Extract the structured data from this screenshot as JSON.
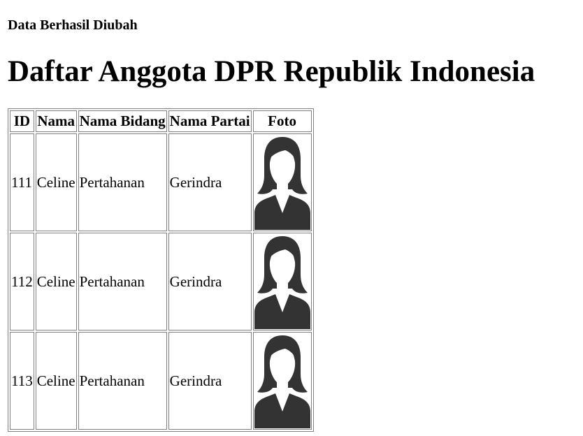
{
  "status_message": "Data Berhasil Diubah",
  "page_title": "Daftar Anggota DPR Republik Indonesia",
  "table": {
    "headers": {
      "id": "ID",
      "nama": "Nama",
      "nama_bidang": "Nama Bidang",
      "nama_partai": "Nama Partai",
      "foto": "Foto"
    },
    "rows": [
      {
        "id": "111",
        "nama": "Celine",
        "nama_bidang": "Pertahanan",
        "nama_partai": "Gerindra",
        "foto_icon": "female-avatar-icon"
      },
      {
        "id": "112",
        "nama": "Celine",
        "nama_bidang": "Pertahanan",
        "nama_partai": "Gerindra",
        "foto_icon": "female-avatar-icon"
      },
      {
        "id": "113",
        "nama": "Celine",
        "nama_bidang": "Pertahanan",
        "nama_partai": "Gerindra",
        "foto_icon": "female-avatar-icon"
      }
    ]
  },
  "colors": {
    "avatar_fill": "#333333",
    "border": "#808080"
  }
}
